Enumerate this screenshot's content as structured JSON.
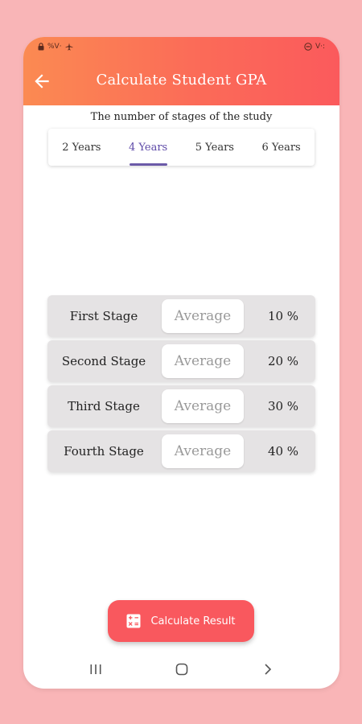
{
  "statusbar": {
    "left_text": "%V·",
    "right_text": "V·:"
  },
  "appbar": {
    "title": "Calculate Student GPA",
    "back_icon": "arrow-left-icon"
  },
  "section": {
    "subtitle": "The number of stages of the study"
  },
  "tabs": [
    {
      "label": "2 Years",
      "active": false
    },
    {
      "label": "4 Years",
      "active": true
    },
    {
      "label": "5 Years",
      "active": false
    },
    {
      "label": "6 Years",
      "active": false
    }
  ],
  "stages": [
    {
      "label": "First Stage",
      "placeholder": "Average",
      "value": "",
      "weight": "10 %"
    },
    {
      "label": "Second Stage",
      "placeholder": "Average",
      "value": "",
      "weight": "20 %"
    },
    {
      "label": "Third Stage",
      "placeholder": "Average",
      "value": "",
      "weight": "30 %"
    },
    {
      "label": "Fourth Stage",
      "placeholder": "Average",
      "value": "",
      "weight": "40 %"
    }
  ],
  "action": {
    "label": "Calculate Result",
    "icon": "calculator-icon"
  },
  "colors": {
    "background": "#f9b5b7",
    "appbar_start": "#fb8a52",
    "appbar_end": "#fb5a5c",
    "tab_active": "#6b5aa8",
    "card": "#e5e3e4",
    "button": "#f9585e"
  }
}
